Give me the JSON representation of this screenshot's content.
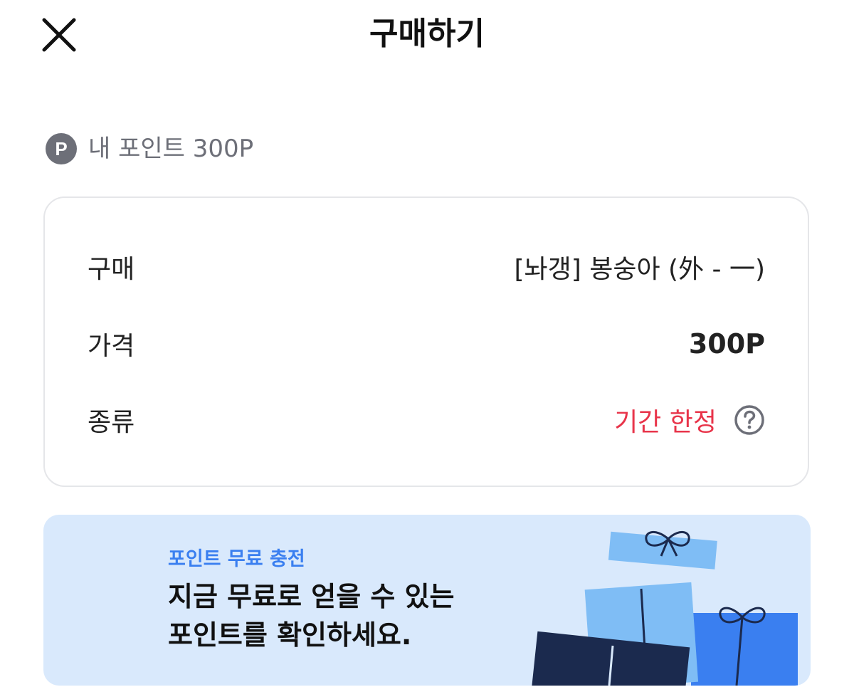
{
  "header": {
    "title": "구매하기",
    "close_icon": "close-icon"
  },
  "points": {
    "badge_letter": "P",
    "label": "내 포인트 300P"
  },
  "purchase_info": {
    "rows": [
      {
        "label": "구매",
        "value": "[놔갱] 봉숭아 (外 - 一)"
      },
      {
        "label": "가격",
        "value": "300P"
      },
      {
        "label": "종류",
        "value": "기간 한정"
      }
    ],
    "help_icon": "question-circle-icon"
  },
  "banner": {
    "subtitle": "포인트 무료 충전",
    "title_line1": "지금 무료로 얻을 수 있는",
    "title_line2": "포인트를 확인하세요.",
    "art": "gift-boxes-illustration"
  },
  "colors": {
    "accent_red": "#e8344a",
    "accent_blue": "#3a7ff0",
    "banner_bg": "#d9e9fc",
    "muted_gray": "#6d6f78"
  }
}
